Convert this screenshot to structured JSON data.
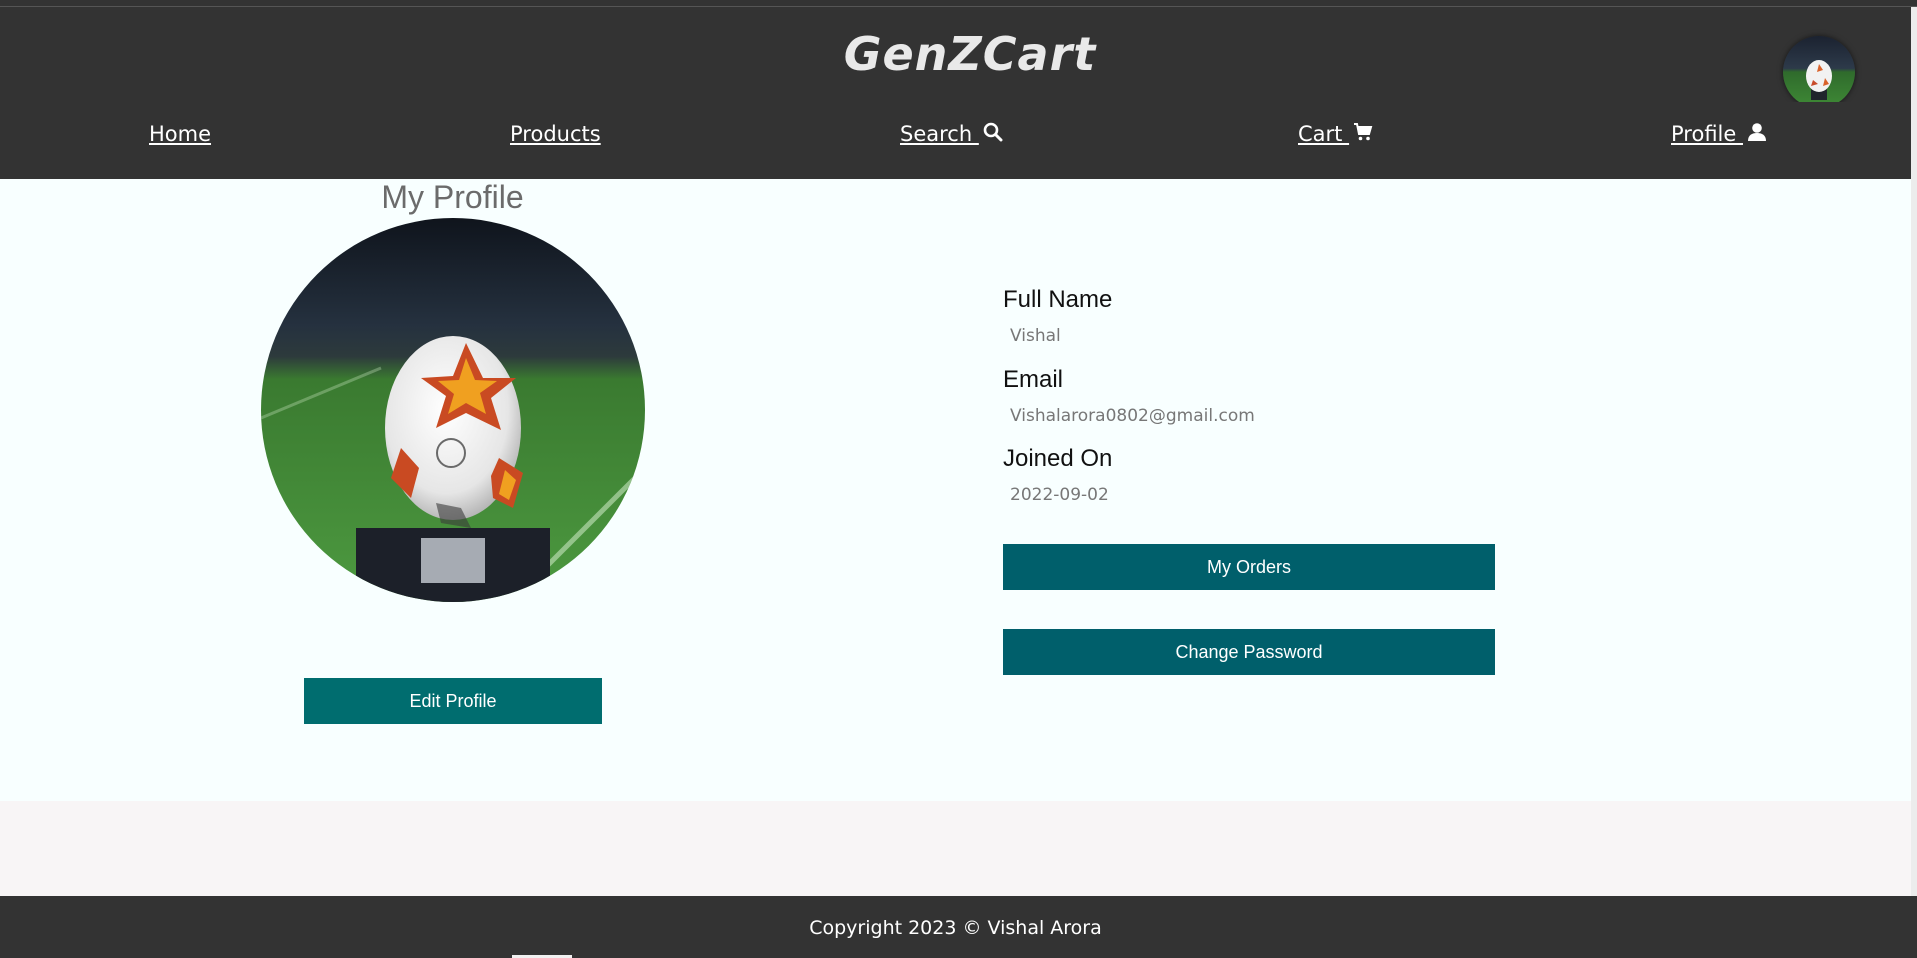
{
  "header": {
    "brand": "GenZCart"
  },
  "nav": {
    "items": [
      {
        "label": "Home"
      },
      {
        "label": "Products"
      },
      {
        "label": "Search ",
        "icon": "search-icon"
      },
      {
        "label": "Cart ",
        "icon": "cart-icon"
      },
      {
        "label": "Profile ",
        "icon": "user-icon"
      }
    ]
  },
  "profile": {
    "title": "My Profile",
    "edit_label": "Edit Profile",
    "fields": [
      {
        "label": "Full Name",
        "value": "Vishal"
      },
      {
        "label": "Email",
        "value": "Vishalarora0802@gmail.com"
      },
      {
        "label": "Joined On",
        "value": "2022-09-02"
      }
    ],
    "orders_label": "My Orders",
    "password_label": "Change Password"
  },
  "footer": {
    "text": "Copyright 2023 © Vishal Arora"
  },
  "colors": {
    "header_bg": "#333333",
    "button_teal": "#005f6b",
    "button_edit": "#006d6f",
    "content_bg": "#f8ffff"
  }
}
